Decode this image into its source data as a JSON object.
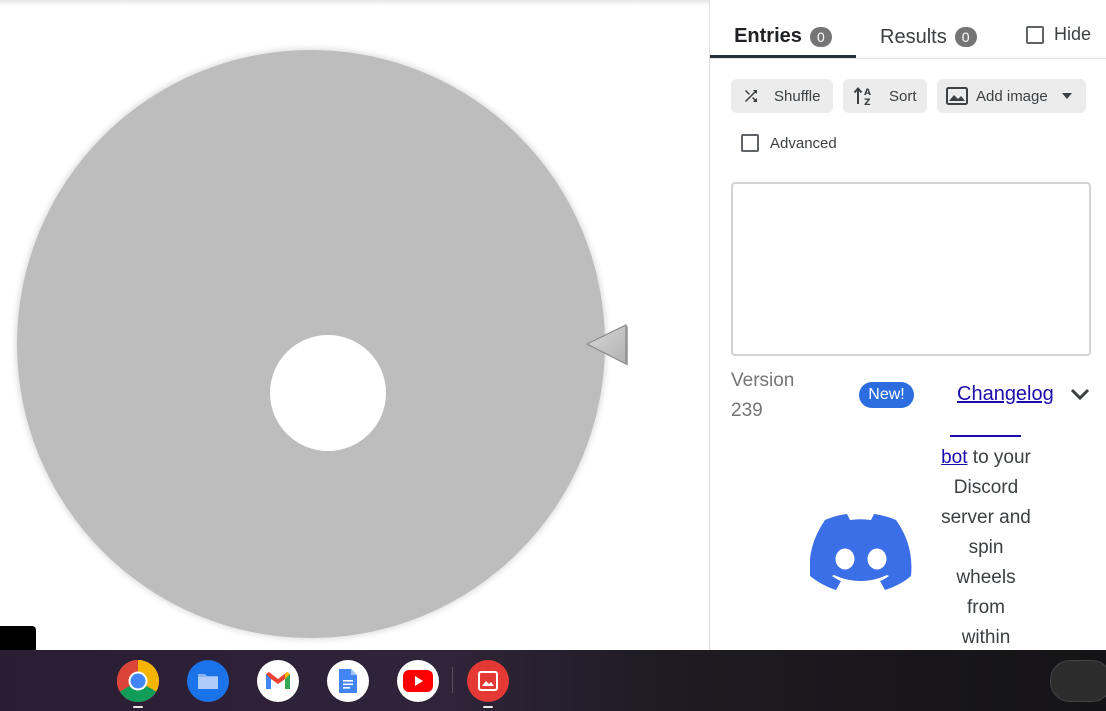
{
  "tabs": {
    "entries": {
      "label": "Entries",
      "count": "0"
    },
    "results": {
      "label": "Results",
      "count": "0"
    },
    "hide_label": "Hide"
  },
  "toolbar": {
    "shuffle_label": "Shuffle",
    "sort_label": "Sort",
    "add_image_label": "Add image"
  },
  "advanced_label": "Advanced",
  "entries_text": "",
  "version": {
    "label": "Version",
    "number": "239"
  },
  "new_badge": "New!",
  "changelog_label": "Changelog",
  "promo": {
    "link": "bot",
    "lines": [
      "to your",
      "Discord",
      "server and",
      "spin",
      "wheels",
      "from",
      "within"
    ]
  },
  "shelf": {
    "apps": [
      "chrome-icon",
      "files-icon",
      "gmail-icon",
      "docs-icon",
      "youtube-icon",
      "gallery-icon"
    ]
  },
  "colors": {
    "wheel": "#bdbdbd",
    "accent": "#2b6cdf",
    "discord": "#3b6fe8",
    "badge": "#757575",
    "link": "#1a0dab"
  }
}
